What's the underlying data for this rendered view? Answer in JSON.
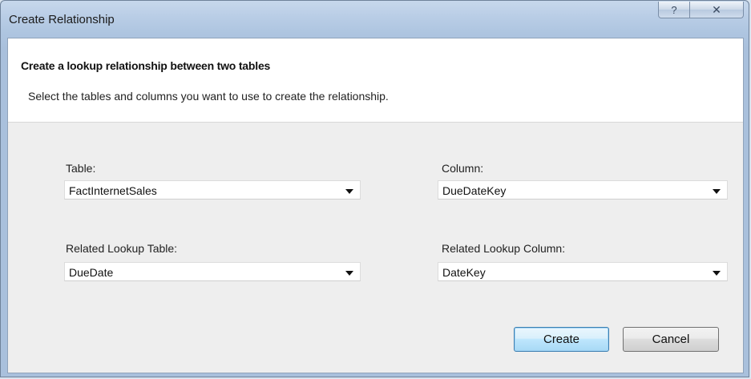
{
  "window": {
    "title": "Create Relationship",
    "help_glyph": "?",
    "close_glyph": "✕"
  },
  "header": {
    "title": "Create a lookup relationship between two tables",
    "description": "Select the tables and columns you want to use to create the relationship."
  },
  "form": {
    "table": {
      "label": "Table:",
      "value": "FactInternetSales"
    },
    "column": {
      "label": "Column:",
      "value": "DueDateKey"
    },
    "related_table": {
      "label": "Related Lookup Table:",
      "value": "DueDate"
    },
    "related_column": {
      "label": "Related Lookup Column:",
      "value": "DateKey"
    }
  },
  "buttons": {
    "create": "Create",
    "cancel": "Cancel"
  }
}
